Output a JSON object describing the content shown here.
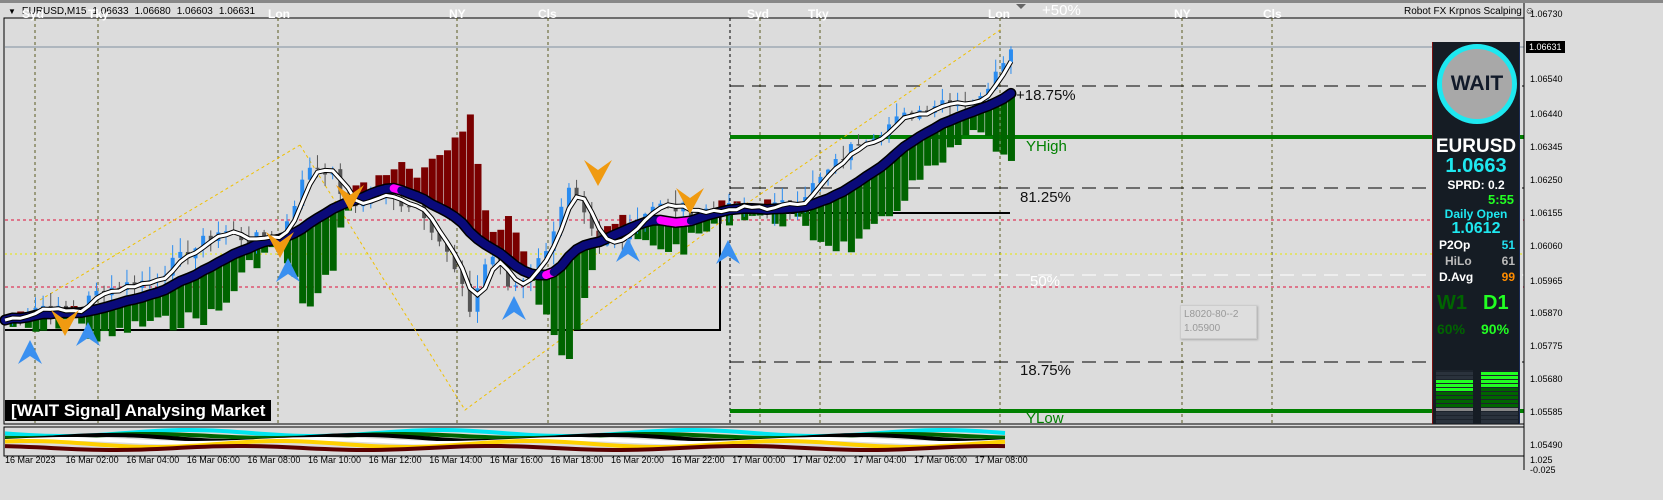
{
  "header": {
    "symbol": "EURUSD,M15",
    "open": "1.06633",
    "high": "1.06680",
    "low": "1.06603",
    "close": "1.06631"
  },
  "robot_label": "Robot FX Krpnos Scalping ☺",
  "sessions": [
    "Syd",
    "Tky",
    "Lon",
    "NY",
    "Cls",
    "Syd",
    "Tky",
    "Lon",
    "NY",
    "Cls"
  ],
  "levels": {
    "plus50": "+50%",
    "plus1875": "+18.75%",
    "yhigh": "YHigh",
    "p8125": "81.25%",
    "p50": "50%",
    "p1875": "18.75%",
    "ylow": "YLow"
  },
  "tooltip": {
    "line1": "L8020-80--2",
    "line2": "1.05900"
  },
  "banner": "[WAIT Signal] Analysing Market",
  "price_axis": [
    "1.06730",
    "1.06540",
    "1.06440",
    "1.06345",
    "1.06250",
    "1.06155",
    "1.06060",
    "1.05965",
    "1.05870",
    "1.05775",
    "1.05680",
    "1.05585",
    "1.05490"
  ],
  "current_price": "1.06631",
  "sub_axis": [
    "1.025",
    "-0.025"
  ],
  "time_axis": [
    "16 Mar 2023",
    "16 Mar 02:00",
    "16 Mar 04:00",
    "16 Mar 06:00",
    "16 Mar 08:00",
    "16 Mar 10:00",
    "16 Mar 12:00",
    "16 Mar 14:00",
    "16 Mar 16:00",
    "16 Mar 18:00",
    "16 Mar 20:00",
    "16 Mar 22:00",
    "17 Mar 00:00",
    "17 Mar 02:00",
    "17 Mar 04:00",
    "17 Mar 06:00",
    "17 Mar 08:00"
  ],
  "panel": {
    "signal": "WAIT",
    "symbol": "EURUSD",
    "price": "1.0663",
    "spread": "SPRD: 0.2",
    "timer": "5:55",
    "daily_open_label": "Daily Open",
    "daily_open": "1.0612",
    "stats": [
      {
        "label": "P2Op",
        "value": "51",
        "color": "#22e0f0"
      },
      {
        "label": "HiLo",
        "value": "61",
        "color": "#bbbbbb"
      },
      {
        "label": "D.Avg",
        "value": "99",
        "color": "#ff8c00"
      }
    ],
    "w1": {
      "label": "W1",
      "pct": "60%",
      "strength": 0.6
    },
    "d1": {
      "label": "D1",
      "pct": "90%",
      "strength": 0.9
    }
  },
  "price_path": [
    [
      0,
      1.05852
    ],
    [
      1.16,
      1.05895
    ],
    [
      2.15,
      1.05866
    ],
    [
      3.14,
      1.05938
    ],
    [
      4.79,
      1.05967
    ],
    [
      7.1,
      1.06111
    ],
    [
      8.09,
      1.06082
    ],
    [
      9.08,
      1.06097
    ],
    [
      10.07,
      1.06298
    ],
    [
      10.73,
      1.06284
    ],
    [
      11.39,
      1.06169
    ],
    [
      12.05,
      1.06212
    ],
    [
      13.7,
      1.06183
    ],
    [
      14.69,
      1.06025
    ],
    [
      15.35,
      1.05881
    ],
    [
      16.0,
      1.06053
    ],
    [
      16.67,
      1.05938
    ],
    [
      17.66,
      1.06025
    ],
    [
      18.65,
      1.06226
    ],
    [
      19.64,
      1.06053
    ],
    [
      20.3,
      1.06097
    ],
    [
      21.29,
      1.06183
    ],
    [
      22.6,
      1.06169
    ],
    [
      24.26,
      1.06169
    ],
    [
      25.9,
      1.06183
    ],
    [
      26.9,
      1.06255
    ],
    [
      28.2,
      1.0637
    ],
    [
      29.5,
      1.06428
    ],
    [
      30.9,
      1.06485
    ],
    [
      32.2,
      1.06485
    ],
    [
      32.8,
      1.066
    ],
    [
      33.2,
      1.06631
    ]
  ],
  "colors": {
    "bull": "#2a8cf0",
    "bear": "#555555",
    "ma_up": "#0a0a7a",
    "ma_flat": "#ff00ff",
    "hist_up": "#006400",
    "hist_down": "#7a0000",
    "yhigh": "#008000"
  }
}
